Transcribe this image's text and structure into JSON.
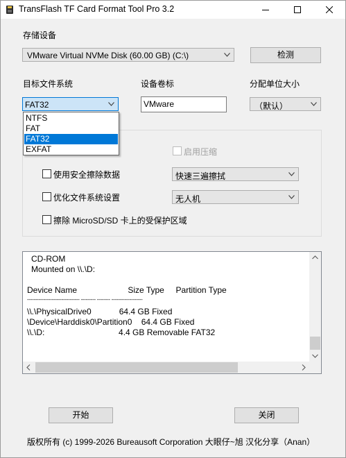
{
  "window": {
    "title": "TransFlash TF Card Format Tool Pro 3.2"
  },
  "storage": {
    "label": "存储设备",
    "selected": "VMware Virtual NVMe Disk (60.00 GB) (C:\\)",
    "detect_button": "检测"
  },
  "filesystem": {
    "label": "目标文件系统",
    "selected": "FAT32",
    "options": [
      "NTFS",
      "FAT",
      "FAT32",
      "EXFAT"
    ],
    "selected_index": 2
  },
  "volume": {
    "label": "设备卷标",
    "value": "VMware"
  },
  "alloc": {
    "label": "分配单位大小",
    "selected": "（默认）"
  },
  "options": {
    "compress": {
      "label": "启用压缩",
      "checked": false,
      "enabled": false
    },
    "secure_erase": {
      "label": "使用安全擦除数据",
      "checked": false,
      "mode": "快速三遍擦拭"
    },
    "optimize": {
      "label": "优化文件系统设置",
      "checked": false,
      "mode": "无人机"
    },
    "erase_protected": {
      "label": "擦除 MicroSD/SD 卡上的受保护区域",
      "checked": false
    }
  },
  "log": {
    "lines": [
      "CD-ROM",
      "Mounted on \\\\.\\D:",
      "",
      "Device Name                      Size Type     Partition Type",
      "-------------------------------- --------- -------- -------------------",
      "\\\\.\\PhysicalDrive0            64.4 GB Fixed",
      "\\Device\\Harddisk0\\Partition0    64.4 GB Fixed",
      "\\\\.\\D:                                4.4 GB Removable FAT32"
    ]
  },
  "buttons": {
    "start": "开始",
    "close": "关闭"
  },
  "footer": {
    "copyright": "版权所有 (c) 1999-2026 Bureausoft Corporation 大眼仔~旭 汉化分享（Anan）"
  },
  "colors": {
    "selection": "#0078d7",
    "window_bg": "#f0f0f0"
  }
}
